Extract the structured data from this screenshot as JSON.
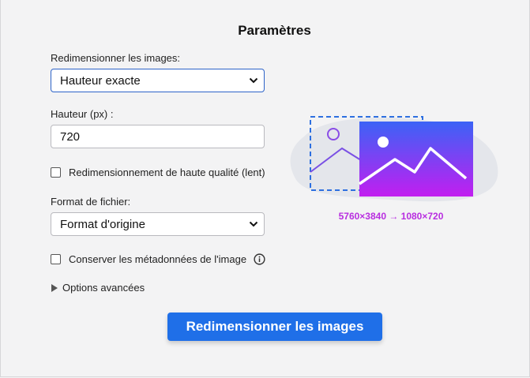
{
  "header": {
    "title": "Paramètres"
  },
  "resize": {
    "label": "Redimensionner les images:",
    "selected": "Hauteur exacte"
  },
  "height": {
    "label": "Hauteur (px) :",
    "value": "720"
  },
  "quality_checkbox": {
    "label": "Redimensionnement de haute qualité (lent)",
    "checked": false
  },
  "format": {
    "label": "Format de fichier:",
    "selected": "Format d'origine"
  },
  "metadata_checkbox": {
    "label": "Conserver les métadonnées de l'image",
    "checked": false
  },
  "advanced": {
    "label": "Options avancées"
  },
  "submit": {
    "label": "Redimensionner les images"
  },
  "illustration": {
    "dimensions": "5760×3840 → 1080×720"
  },
  "colors": {
    "accent": "#1f6fe8",
    "gradient_top": "#3b63f6",
    "gradient_bottom": "#c21ef0",
    "dims_text": "#b82ee0"
  },
  "icons": [
    "chevron-down-icon",
    "info-icon",
    "triangle-right-icon",
    "image-icon"
  ]
}
